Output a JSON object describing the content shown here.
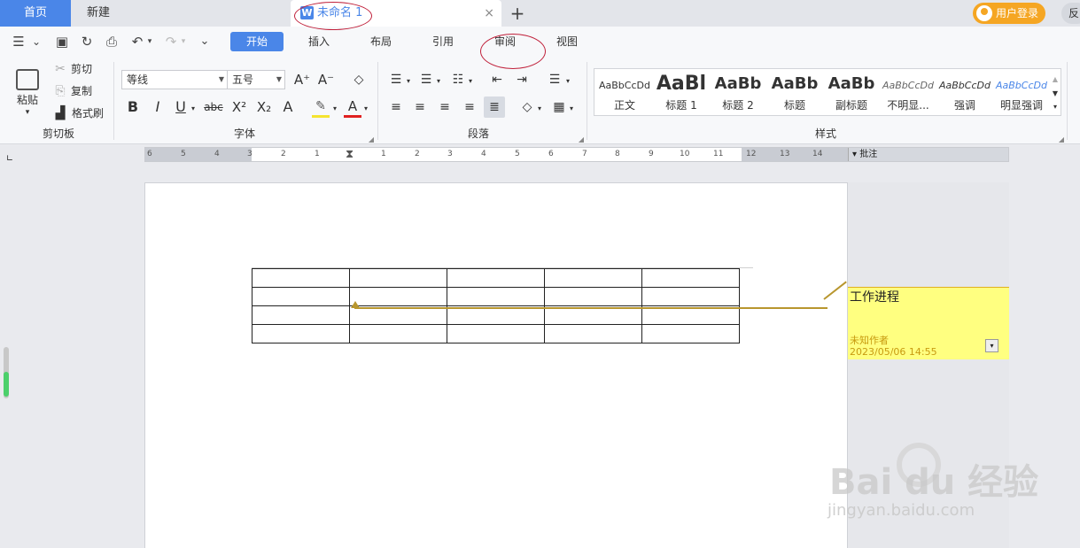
{
  "tabs": {
    "home": "首页",
    "new": "新建",
    "document": "未命名 1",
    "document_logo": "W",
    "close": "×",
    "add": "+"
  },
  "account": {
    "login": "用户登录",
    "feedback": "反"
  },
  "quick_icons": {
    "menu": "☰",
    "menu_chevron": "⌄",
    "save": "▣",
    "redo_file": "↻",
    "print": "⎙",
    "undo": "↶",
    "undo_drop": "▾",
    "redo": "↷",
    "redo_drop": "▾",
    "more": "⌄"
  },
  "menu_tabs": [
    "开始",
    "插入",
    "布局",
    "引用",
    "审阅",
    "视图"
  ],
  "clipboard": {
    "paste": "粘贴",
    "paste_drop": "▾",
    "cut": "剪切",
    "copy": "复制",
    "format_painter": "格式刷",
    "group": "剪切板"
  },
  "font": {
    "name": "等线",
    "size": "五号",
    "grow": "A⁺",
    "shrink": "A⁻",
    "bold": "B",
    "italic": "I",
    "underline": "U",
    "strike": "abc",
    "superscript": "X²",
    "subscript": "X₂",
    "effect": "A",
    "highlight": "✎",
    "color": "A",
    "group": "字体"
  },
  "paragraph": {
    "group": "段落"
  },
  "styles": {
    "group": "样式",
    "items": [
      {
        "preview": "AaBbCcDd",
        "name": "正文"
      },
      {
        "preview": "AaBl",
        "name": "标题 1"
      },
      {
        "preview": "AaBb",
        "name": "标题 2"
      },
      {
        "preview": "AaBb",
        "name": "标题"
      },
      {
        "preview": "AaBb",
        "name": "副标题"
      },
      {
        "preview": "AaBbCcDd",
        "name": "不明显..."
      },
      {
        "preview": "AaBbCcDd",
        "name": "强调"
      },
      {
        "preview": "AaBbCcDd",
        "name": "明显强调"
      }
    ]
  },
  "ruler": {
    "left_ticks": [
      "6",
      "5",
      "4",
      "3",
      "2",
      "1"
    ],
    "right_ticks": [
      "1",
      "2",
      "3",
      "4",
      "5",
      "6",
      "7",
      "8",
      "9",
      "10",
      "11"
    ],
    "margin_ticks": [
      "12",
      "13",
      "14"
    ],
    "comment_label": "▾ 批注"
  },
  "table": {
    "rows": 4,
    "cols": 5
  },
  "comment": {
    "text": "工作进程",
    "author": "未知作者",
    "time": "2023/05/06 14:55",
    "menu": "▾"
  },
  "watermark": {
    "logo": "Bai  du 经验",
    "url": "jingyan.baidu.com"
  },
  "colors": {
    "accent": "#4a86e8",
    "comment_bg": "#ffff80",
    "comment_line": "#b8962e",
    "login": "#f5a623"
  }
}
